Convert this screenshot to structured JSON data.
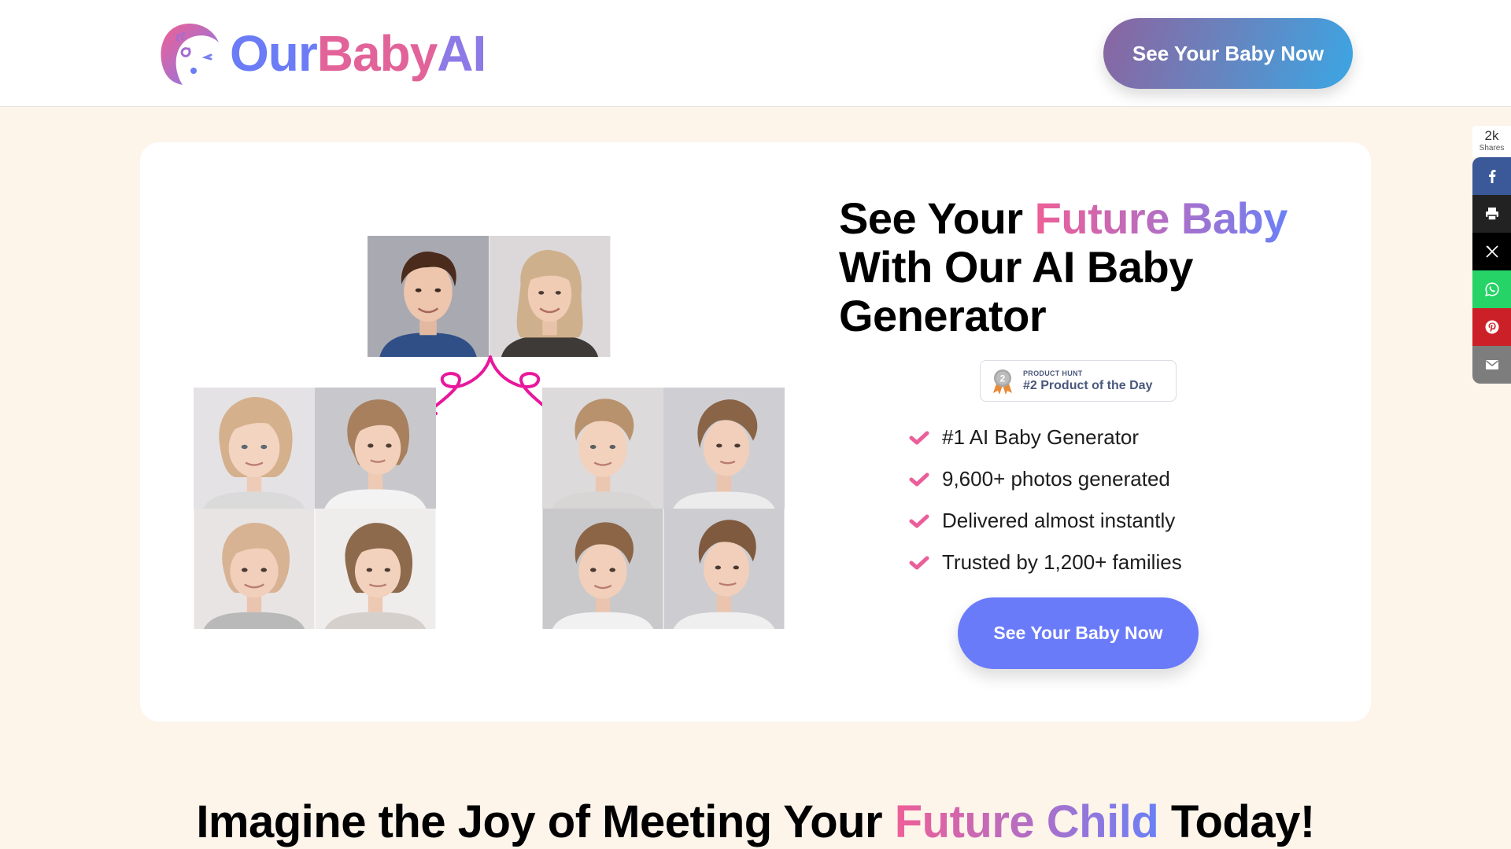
{
  "header": {
    "logo": {
      "part1": "Our",
      "part2": "Baby",
      "part3": "AI",
      "icon": "baby-face-logo-icon"
    },
    "cta_label": "See Your Baby Now"
  },
  "hero": {
    "title_line1_prefix": "See Your ",
    "title_line1_highlight": "Future Baby",
    "title_line2": "With Our AI Baby",
    "title_line3": "Generator",
    "product_hunt": {
      "label_small": "PRODUCT HUNT",
      "label_big": "#2 Product of the Day",
      "medal_rank": "2",
      "icon": "silver-medal-icon"
    },
    "features": [
      {
        "text": "#1 AI Baby Generator",
        "icon": "check-icon"
      },
      {
        "text": "9,600+ photos generated",
        "icon": "check-icon"
      },
      {
        "text": "Delivered almost instantly",
        "icon": "check-icon"
      },
      {
        "text": "Trusted by 1,200+ families",
        "icon": "check-icon"
      }
    ],
    "cta_label": "See Your Baby Now",
    "images": {
      "parents": [
        "father-portrait",
        "mother-portrait"
      ],
      "girls": [
        "girl-portrait-1",
        "girl-portrait-2",
        "girl-portrait-3",
        "girl-portrait-4"
      ],
      "boys": [
        "boy-portrait-1",
        "boy-portrait-2",
        "boy-portrait-3",
        "boy-portrait-4"
      ]
    }
  },
  "section": {
    "title_prefix": "Imagine the Joy of Meeting Your ",
    "title_highlight": "Future Child",
    "title_suffix": " Today!"
  },
  "share_bar": {
    "count": "2k",
    "count_label": "Shares",
    "buttons": [
      {
        "network": "facebook",
        "icon": "facebook-icon",
        "color": "#3b5998"
      },
      {
        "network": "print",
        "icon": "print-icon",
        "color": "#222222"
      },
      {
        "network": "x",
        "icon": "x-icon",
        "color": "#000000"
      },
      {
        "network": "whatsapp",
        "icon": "whatsapp-icon",
        "color": "#25d366"
      },
      {
        "network": "pinterest",
        "icon": "pinterest-icon",
        "color": "#cb2027"
      },
      {
        "network": "email",
        "icon": "email-icon",
        "color": "#7d7d7d"
      }
    ]
  },
  "colors": {
    "page_bg": "#fdf4ea",
    "brand_blue": "#6b7cf6",
    "brand_pink": "#e26399",
    "cta_solid": "#6a7bfa",
    "check_pink": "#ea5f9a",
    "arrow_magenta": "#e8179c"
  }
}
